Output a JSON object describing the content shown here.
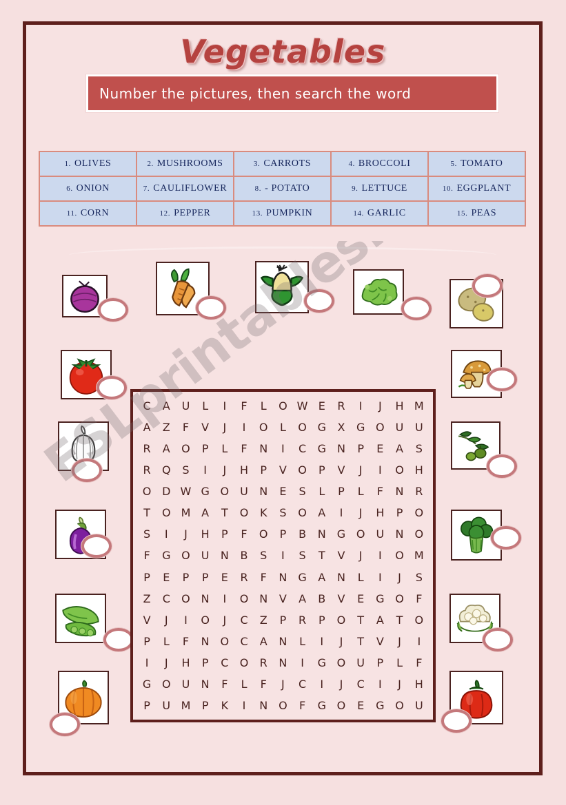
{
  "title": "Vegetables",
  "instruction": "Number the pictures, then  search the word",
  "watermark": "ESLprintables.com",
  "colors": {
    "page_bg": "#f6e0e0",
    "border": "#5e1f1c",
    "title_text": "#b5423f",
    "instruction_bar": "#c0504d",
    "wordlist_cell": "#ccd9ee",
    "wordlist_border": "#d98b7e",
    "wordlist_text": "#16265c",
    "grid_letter": "#48221f",
    "oval_ring": "#c4787b"
  },
  "wordlist": {
    "rows": [
      [
        {
          "num": "1.",
          "word": "OLIVES"
        },
        {
          "num": "2.",
          "word": "MUSHROOMS"
        },
        {
          "num": "3.",
          "word": "CARROTS"
        },
        {
          "num": "4.",
          "word": "BROCCOLI"
        },
        {
          "num": "5.",
          "word": "TOMATO"
        }
      ],
      [
        {
          "num": "6.",
          "word": "ONION"
        },
        {
          "num": "7.",
          "word": "CAULIFLOWER"
        },
        {
          "num": "8.",
          "word": "- POTATO"
        },
        {
          "num": "9.",
          "word": "LETTUCE"
        },
        {
          "num": "10.",
          "word": "EGGPLANT"
        }
      ],
      [
        {
          "num": "11.",
          "word": "CORN"
        },
        {
          "num": "12.",
          "word": "PEPPER"
        },
        {
          "num": "13.",
          "word": "PUMPKIN"
        },
        {
          "num": "14.",
          "word": "GARLIC"
        },
        {
          "num": "15.",
          "word": "PEAS"
        }
      ]
    ]
  },
  "grid": {
    "rows": 15,
    "cols": 15,
    "letters": [
      [
        "C",
        "A",
        "U",
        "L",
        "I",
        "F",
        "L",
        "O",
        "W",
        "E",
        "R",
        "I",
        "J",
        "H",
        "M"
      ],
      [
        "A",
        "Z",
        "F",
        "V",
        "J",
        "I",
        "O",
        "L",
        "O",
        "G",
        "X",
        "G",
        "O",
        "U",
        "U"
      ],
      [
        "R",
        "A",
        "O",
        "P",
        "L",
        "F",
        "N",
        "I",
        "C",
        "G",
        "N",
        "P",
        "E",
        "A",
        "S"
      ],
      [
        "R",
        "Q",
        "S",
        "I",
        "J",
        "H",
        "P",
        "V",
        "O",
        "P",
        "V",
        "J",
        "I",
        "O",
        "H"
      ],
      [
        "O",
        "D",
        "W",
        "G",
        "O",
        "U",
        "N",
        "E",
        "S",
        "L",
        "P",
        "L",
        "F",
        "N",
        "R"
      ],
      [
        "T",
        "O",
        "M",
        "A",
        "T",
        "O",
        "K",
        "S",
        "O",
        "A",
        "I",
        "J",
        "H",
        "P",
        "O"
      ],
      [
        "S",
        "I",
        "J",
        "H",
        "P",
        "F",
        "O",
        "P",
        "B",
        "N",
        "G",
        "O",
        "U",
        "N",
        "O"
      ],
      [
        "F",
        "G",
        "O",
        "U",
        "N",
        "B",
        "S",
        "I",
        "S",
        "T",
        "V",
        "J",
        "I",
        "O",
        "M"
      ],
      [
        "P",
        "E",
        "P",
        "P",
        "E",
        "R",
        "F",
        "N",
        "G",
        "A",
        "N",
        "L",
        "I",
        "J",
        "S"
      ],
      [
        "Z",
        "C",
        "O",
        "N",
        "I",
        "O",
        "N",
        "V",
        "A",
        "B",
        "V",
        "E",
        "G",
        "O",
        "F"
      ],
      [
        "V",
        "J",
        "I",
        "O",
        "J",
        "C",
        "Z",
        "P",
        "R",
        "P",
        "O",
        "T",
        "A",
        "T",
        "O"
      ],
      [
        "P",
        "L",
        "F",
        "N",
        "O",
        "C",
        "A",
        "N",
        "L",
        "I",
        "J",
        "T",
        "V",
        "J",
        "I"
      ],
      [
        "I",
        "J",
        "H",
        "P",
        "C",
        "O",
        "R",
        "N",
        "I",
        "G",
        "O",
        "U",
        "P",
        "L",
        "F"
      ],
      [
        "G",
        "O",
        "U",
        "N",
        "F",
        "L",
        "F",
        "J",
        "C",
        "I",
        "J",
        "C",
        "I",
        "J",
        "H"
      ],
      [
        "P",
        "U",
        "M",
        "P",
        "K",
        "I",
        "N",
        "O",
        "F",
        "G",
        "O",
        "E",
        "G",
        "O",
        "U"
      ]
    ]
  },
  "pictures": [
    {
      "name": "red-onion",
      "answer": ""
    },
    {
      "name": "carrots",
      "answer": ""
    },
    {
      "name": "corn",
      "answer": ""
    },
    {
      "name": "lettuce",
      "answer": ""
    },
    {
      "name": "potato",
      "answer": ""
    },
    {
      "name": "tomato",
      "answer": ""
    },
    {
      "name": "garlic",
      "answer": ""
    },
    {
      "name": "eggplant",
      "answer": ""
    },
    {
      "name": "peas",
      "answer": ""
    },
    {
      "name": "pumpkin",
      "answer": ""
    },
    {
      "name": "mushrooms",
      "answer": ""
    },
    {
      "name": "olives",
      "answer": ""
    },
    {
      "name": "broccoli",
      "answer": ""
    },
    {
      "name": "cauliflower",
      "answer": ""
    },
    {
      "name": "pepper",
      "answer": ""
    }
  ]
}
